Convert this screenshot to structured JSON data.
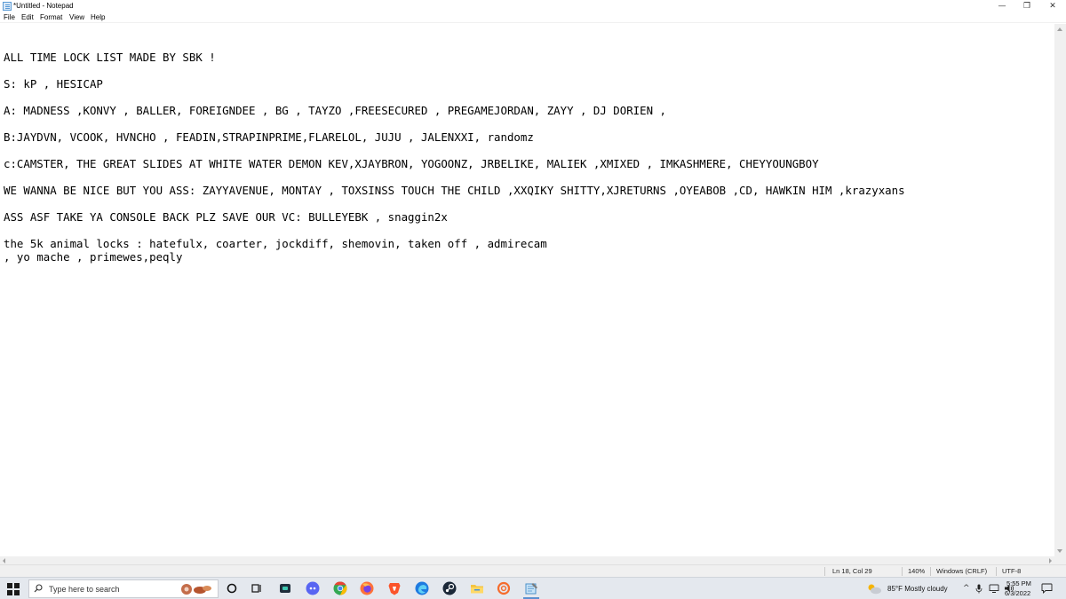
{
  "window": {
    "title": "*Untitled - Notepad",
    "minimize_glyph": "—",
    "maximize_glyph": "❐",
    "close_glyph": "✕"
  },
  "menu": {
    "items": [
      "File",
      "Edit",
      "Format",
      "View",
      "Help"
    ]
  },
  "editor": {
    "lines": [
      "ALL TIME LOCK LIST MADE BY SBK !",
      "S: kP , HESICAP",
      "A: MADNESS ,KONVY , BALLER, FOREIGNDEE , BG , TAYZO ,FREESECURED , PREGAMEJORDAN, ZAYY , DJ DORIEN ,",
      "B:JAYDVN, VCOOK, HVNCHO , FEADIN,STRAPINPRIME,FLARELOL, JUJU , JALENXXI, randomz",
      "c:CAMSTER, THE GREAT SLIDES AT WHITE WATER DEMON KEV,XJAYBRON, YOGOONZ, JRBELIKE, MALIEK ,XMIXED , IMKASHMERE, CHEYYOUNGBOY",
      "WE WANNA BE NICE BUT YOU ASS: ZAYYAVENUE, MONTAY , TOXSINSS TOUCH THE CHILD ,XXQIKY SHITTY,XJRETURNS ,OYEABOB ,CD, HAWKIN HIM ,krazyxans",
      "ASS ASF TAKE YA CONSOLE BACK PLZ SAVE OUR VC: BULLEYEBK , snaggin2x",
      "the 5k animal locks : hatefulx, coarter, jockdiff, shemovin, taken off , admirecam",
      ", yo mache , primewes,peqly"
    ]
  },
  "status": {
    "position": "Ln 18, Col 29",
    "zoom": "140%",
    "line_ending": "Windows (CRLF)",
    "encoding": "UTF-8"
  },
  "taskbar": {
    "search_placeholder": "Type here to search",
    "weather": "85°F  Mostly cloudy",
    "time": "5:55 PM",
    "date": "6/3/2022",
    "pinned_icons": [
      "cortana-icon",
      "task-view-icon",
      "teams-chat-icon",
      "discord-icon",
      "chrome-icon",
      "firefox-icon",
      "brave-icon",
      "edge-icon",
      "steam-icon",
      "file-explorer-icon",
      "origin-icon",
      "notepad-icon"
    ],
    "accent_color": "#5b8fd0"
  }
}
